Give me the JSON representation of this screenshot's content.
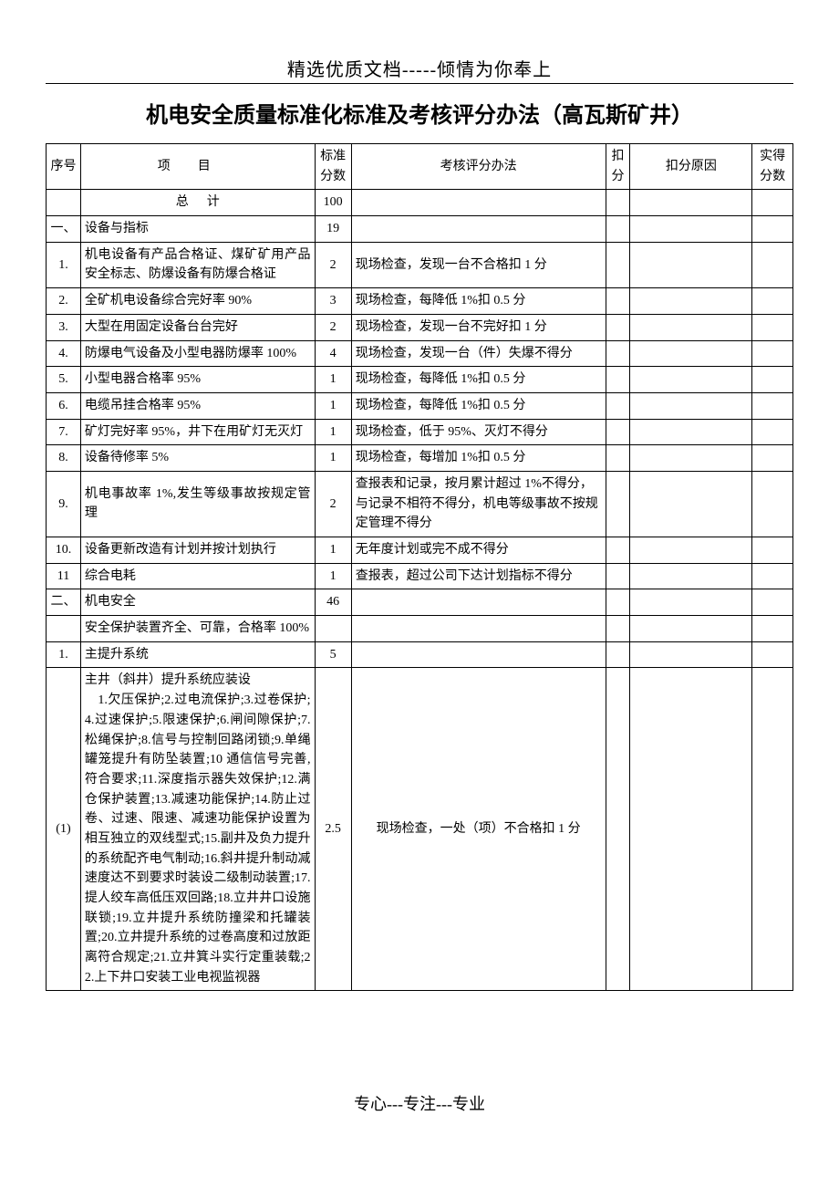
{
  "banner": "精选优质文档-----倾情为你奉上",
  "title": "机电安全质量标准化标准及考核评分办法（高瓦斯矿井）",
  "footer": "专心---专注---专业",
  "headers": {
    "idx": "序号",
    "item": "项目",
    "std": "标准分数",
    "method": "考核评分办法",
    "deduct": "扣分",
    "reason": "扣分原因",
    "score": "实得分数"
  },
  "totalRow": {
    "idx": "",
    "item": "总计",
    "std": "100"
  },
  "rows": [
    {
      "idx": "一、",
      "item": "设备与指标",
      "std": "19",
      "method": "",
      "section": true
    },
    {
      "idx": "1.",
      "item": "机电设备有产品合格证、煤矿矿用产品安全标志、防爆设备有防爆合格证",
      "std": "2",
      "method": "现场检查，发现一台不合格扣 1 分"
    },
    {
      "idx": "2.",
      "item": "全矿机电设备综合完好率 90%",
      "std": "3",
      "method": "现场检查，每降低 1%扣 0.5 分"
    },
    {
      "idx": "3.",
      "item": "大型在用固定设备台台完好",
      "std": "2",
      "method": "现场检查，发现一台不完好扣 1 分"
    },
    {
      "idx": "4.",
      "item": "防爆电气设备及小型电器防爆率 100%",
      "std": "4",
      "method": "现场检查，发现一台（件）失爆不得分"
    },
    {
      "idx": "5.",
      "item": "小型电器合格率 95%",
      "std": "1",
      "method": "现场检查，每降低 1%扣 0.5 分"
    },
    {
      "idx": "6.",
      "item": "电缆吊挂合格率 95%",
      "std": "1",
      "method": "现场检查，每降低 1%扣 0.5 分"
    },
    {
      "idx": "7.",
      "item": "矿灯完好率 95%，井下在用矿灯无灭灯",
      "std": "1",
      "method": "现场检查，低于 95%、灭灯不得分"
    },
    {
      "idx": "8.",
      "item": "设备待修率 5%",
      "std": "1",
      "method": "现场检查，每增加 1%扣 0.5 分"
    },
    {
      "idx": "9.",
      "item": "机电事故率 1%,发生等级事故按规定管理",
      "std": "2",
      "method": "查报表和记录，按月累计超过 1%不得分，与记录不相符不得分，机电等级事故不按规定管理不得分"
    },
    {
      "idx": "10.",
      "item": "设备更新改造有计划并按计划执行",
      "std": "1",
      "method": "无年度计划或完不成不得分"
    },
    {
      "idx": "11",
      "item": "综合电耗",
      "std": "1",
      "method": "查报表，超过公司下达计划指标不得分"
    },
    {
      "idx": "二、",
      "item": "机电安全",
      "std": "46",
      "method": "",
      "section": true
    },
    {
      "idx": "",
      "item": "安全保护装置齐全、可靠，合格率 100%",
      "std": "",
      "method": ""
    },
    {
      "idx": "1.",
      "item": "主提升系统",
      "std": "5",
      "method": ""
    },
    {
      "idx": "(1)",
      "item": "主井（斜井）提升系统应装设\n　1.欠压保护;2.过电流保护;3.过卷保护;4.过速保护;5.限速保护;6.闸间隙保护;7.松绳保护;8.信号与控制回路闭锁;9.单绳罐笼提升有防坠装置;10 通信信号完善,符合要求;11.深度指示器失效保护;12.满仓保护装置;13.减速功能保护;14.防止过卷、过速、限速、减速功能保护设置为相互独立的双线型式;15.副井及负力提升的系统配齐电气制动;16.斜井提升制动减速度达不到要求时装设二级制动装置;17.提人绞车高低压双回路;18.立井井口设施联锁;19.立井提升系统防撞梁和托罐装置;20.立井提升系统的过卷高度和过放距离符合规定;21.立井箕斗实行定重装载;22.上下井口安装工业电视监视器",
      "std": "2.5",
      "method": "现场检查，一处（项）不合格扣 1 分",
      "methodCenter": true
    }
  ]
}
